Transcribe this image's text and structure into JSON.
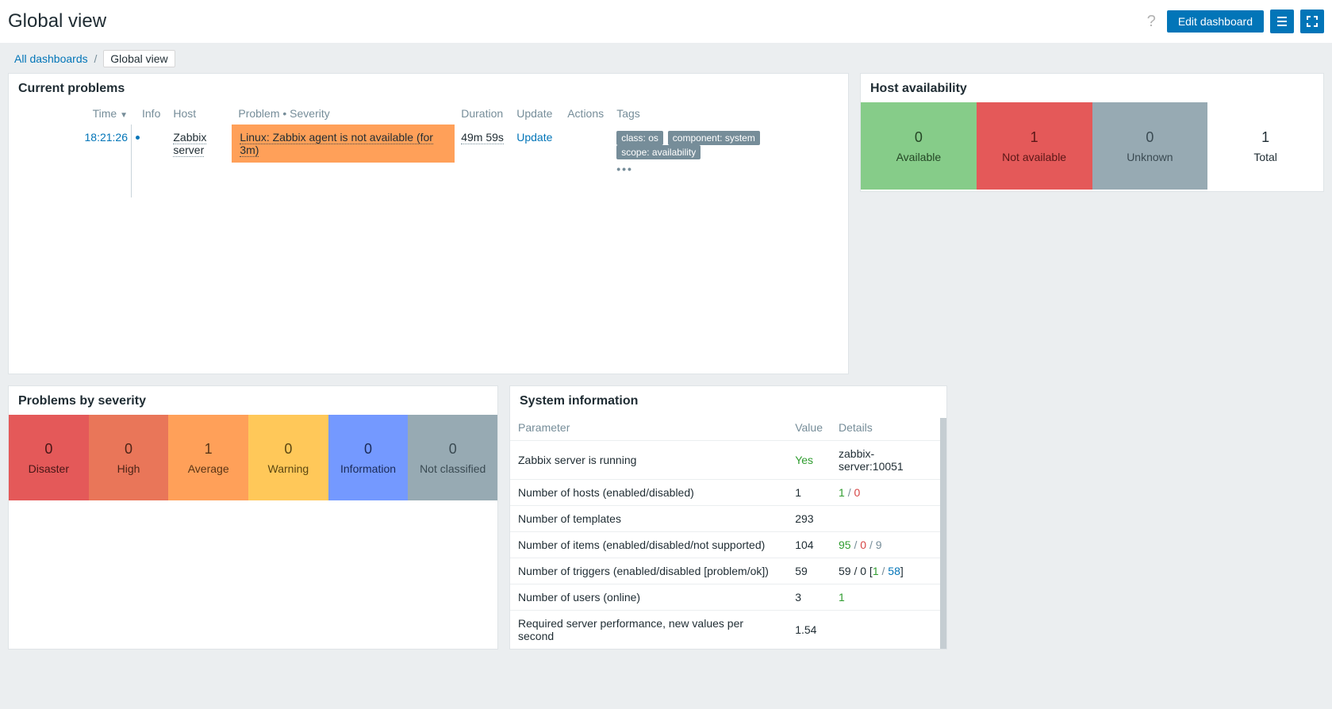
{
  "header": {
    "title": "Global view",
    "edit_button": "Edit dashboard"
  },
  "breadcrumb": {
    "all": "All dashboards",
    "current": "Global view"
  },
  "widgets": {
    "problems": {
      "title": "Current problems",
      "columns": {
        "time": "Time",
        "info": "Info",
        "host": "Host",
        "problem": "Problem • Severity",
        "duration": "Duration",
        "update": "Update",
        "actions": "Actions",
        "tags": "Tags"
      },
      "rows": [
        {
          "time": "18:21:26",
          "host": "Zabbix server",
          "problem": "Linux: Zabbix agent is not available (for 3m)",
          "duration": "49m 59s",
          "update": "Update",
          "tags": [
            "class: os",
            "component: system",
            "scope: availability"
          ]
        }
      ]
    },
    "host_availability": {
      "title": "Host availability",
      "cells": {
        "available": {
          "num": "0",
          "label": "Available"
        },
        "not_available": {
          "num": "1",
          "label": "Not available"
        },
        "unknown": {
          "num": "0",
          "label": "Unknown"
        },
        "total": {
          "num": "1",
          "label": "Total"
        }
      }
    },
    "severity": {
      "title": "Problems by severity",
      "cells": {
        "disaster": {
          "num": "0",
          "label": "Disaster"
        },
        "high": {
          "num": "0",
          "label": "High"
        },
        "average": {
          "num": "1",
          "label": "Average"
        },
        "warning": {
          "num": "0",
          "label": "Warning"
        },
        "information": {
          "num": "0",
          "label": "Information"
        },
        "na": {
          "num": "0",
          "label": "Not classified"
        }
      }
    },
    "sysinfo": {
      "title": "System information",
      "columns": {
        "param": "Parameter",
        "value": "Value",
        "details": "Details"
      },
      "rows": [
        {
          "param": "Zabbix server is running",
          "value_html": "<span class='green'>Yes</span>",
          "details_html": "zabbix-server:10051"
        },
        {
          "param": "Number of hosts (enabled/disabled)",
          "value_html": "1",
          "details_html": "<span class='green'>1</span> <span class='grey'>/</span> <span class='red'>0</span>"
        },
        {
          "param": "Number of templates",
          "value_html": "293",
          "details_html": ""
        },
        {
          "param": "Number of items (enabled/disabled/not supported)",
          "value_html": "104",
          "details_html": "<span class='green'>95</span> <span class='grey'>/</span> <span class='red'>0</span> <span class='grey'>/</span> <span class='grey'>9</span>"
        },
        {
          "param": "Number of triggers (enabled/disabled [problem/ok])",
          "value_html": "59",
          "details_html": "59 / 0 [<span class='green'>1</span> <span class='grey'>/</span> <span class='blue'>58</span>]"
        },
        {
          "param": "Number of users (online)",
          "value_html": "3",
          "details_html": "<span class='green'>1</span>"
        },
        {
          "param": "Required server performance, new values per second",
          "value_html": "1.54",
          "details_html": ""
        }
      ]
    }
  }
}
